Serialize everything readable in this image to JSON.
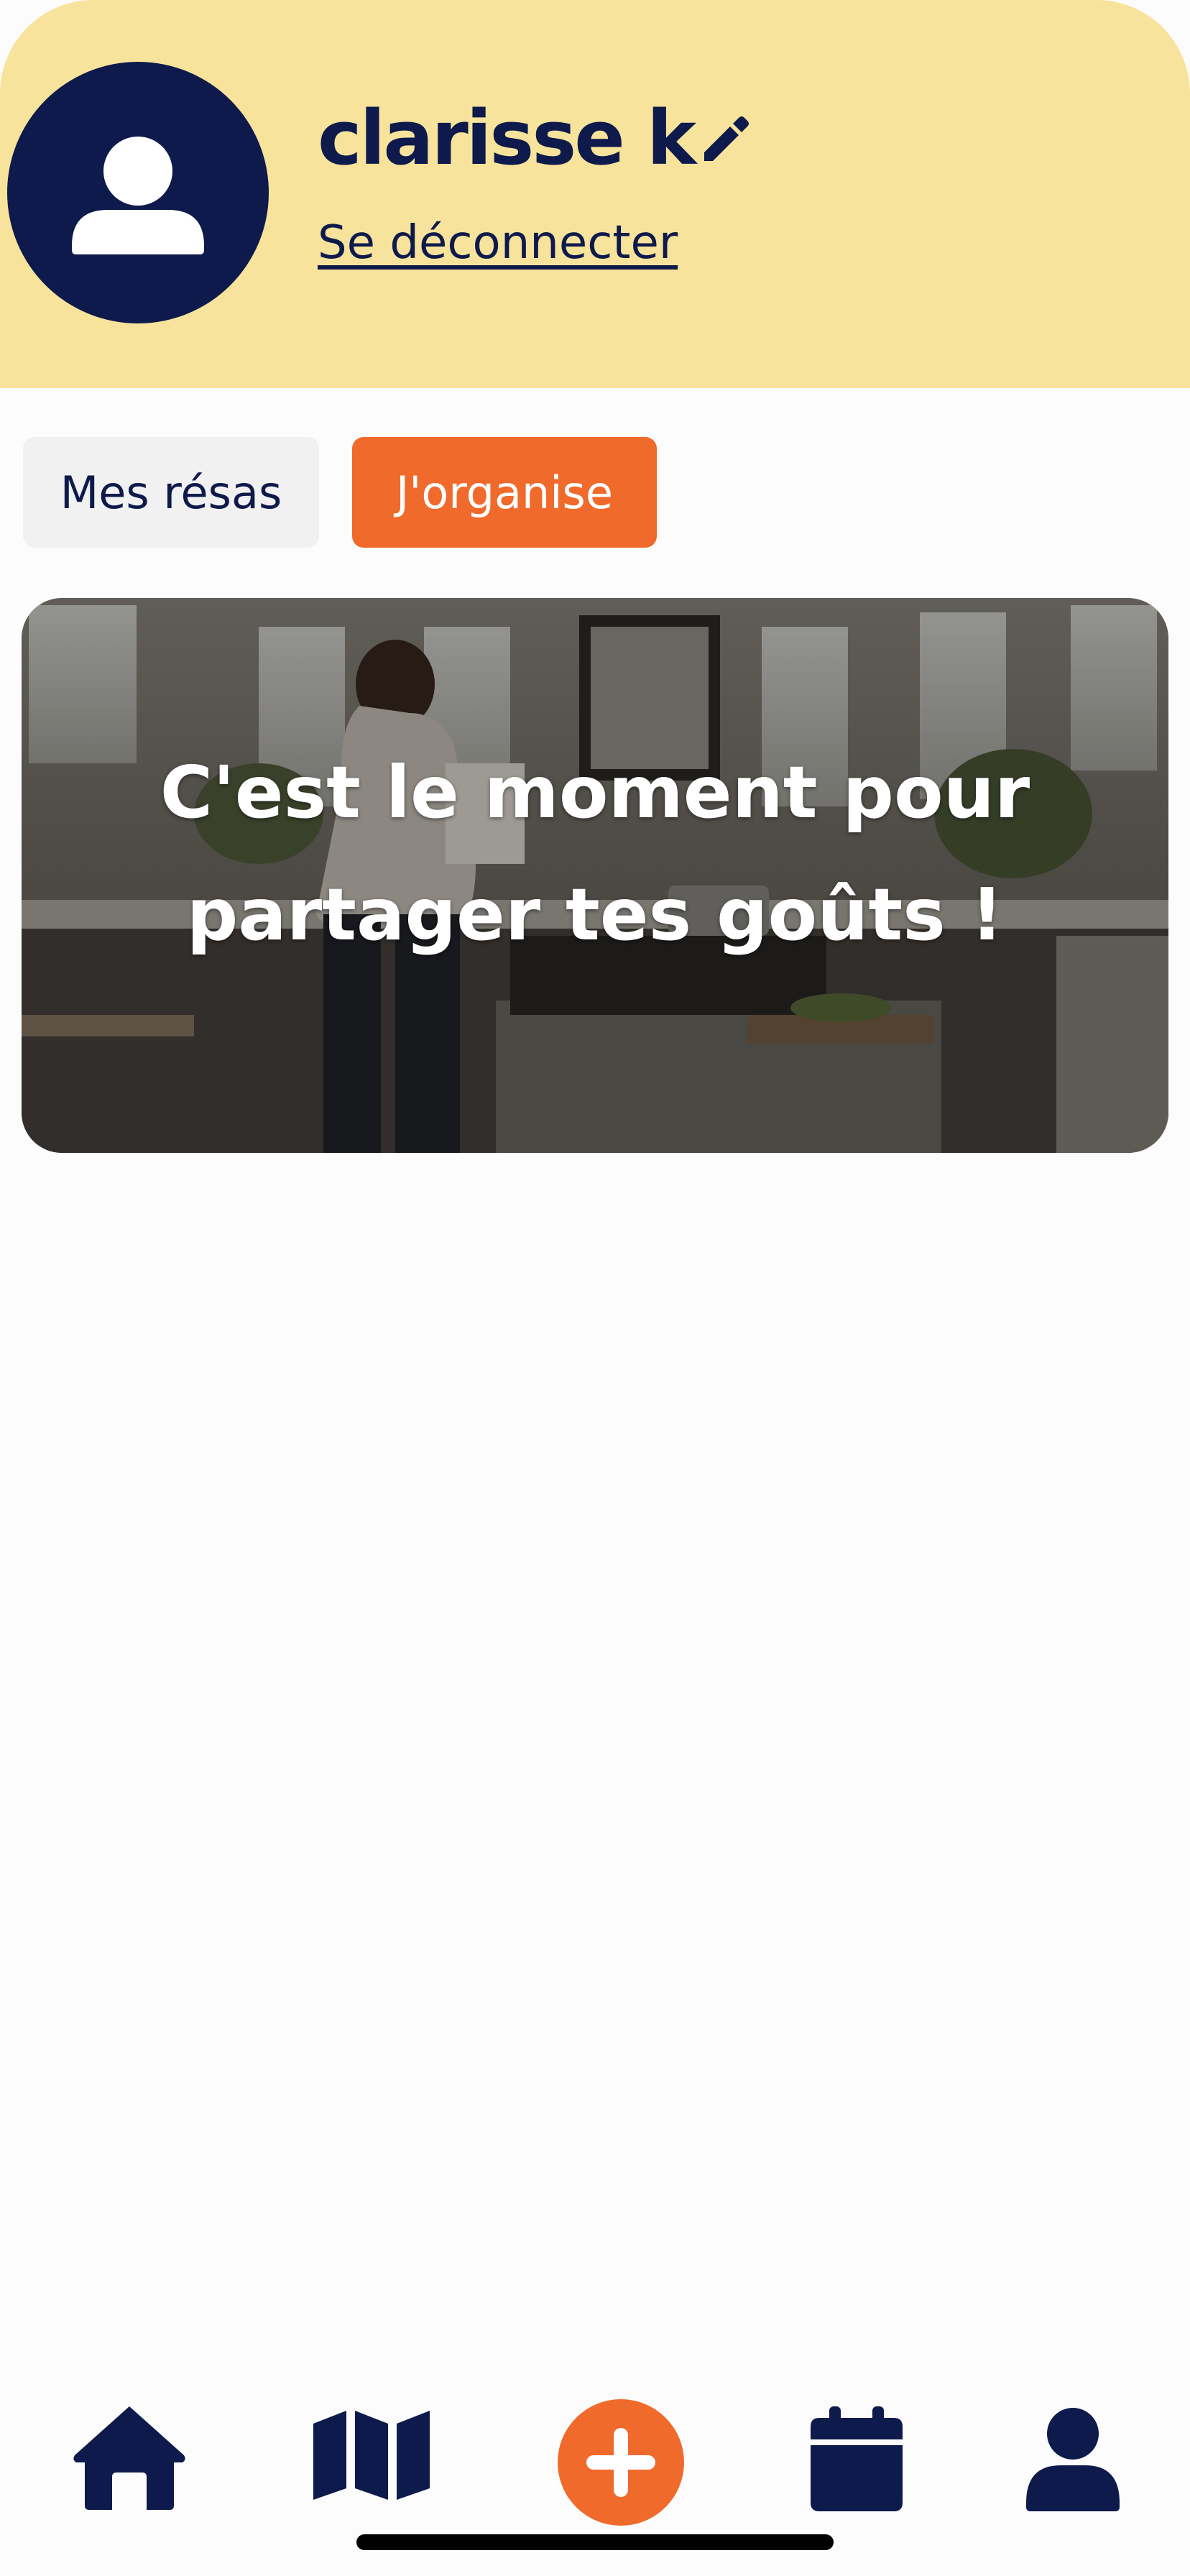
{
  "profile": {
    "name": "clarisse k",
    "logout_label": "Se déconnecter"
  },
  "tabs": [
    {
      "label": "Mes résas",
      "active": false
    },
    {
      "label": "J'organise",
      "active": true
    }
  ],
  "banner": {
    "headline": "C'est le moment pour partager tes goûts !"
  },
  "bottom_nav": {
    "items": [
      "home-icon",
      "map-icon",
      "plus-icon",
      "calendar-icon",
      "user-icon"
    ]
  },
  "colors": {
    "header_bg": "#f8e39c",
    "navy": "#0d1a4b",
    "accent": "#ef6a2b",
    "inactive_tab_bg": "#f1f1f1"
  }
}
